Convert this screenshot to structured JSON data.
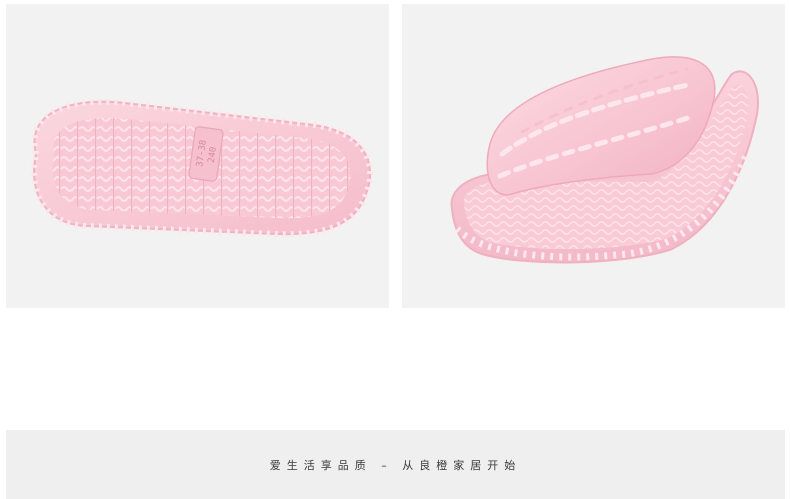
{
  "images": {
    "sole_view": {
      "icon": "slipper-sole-image",
      "size_label_line1": "37-38",
      "size_label_line2": "240",
      "color": "#f7c7d2"
    },
    "side_view": {
      "icon": "slipper-side-image",
      "color": "#f7c7d2"
    }
  },
  "footer": {
    "slogan": "爱生活享品质 – 从良橙家居开始"
  }
}
